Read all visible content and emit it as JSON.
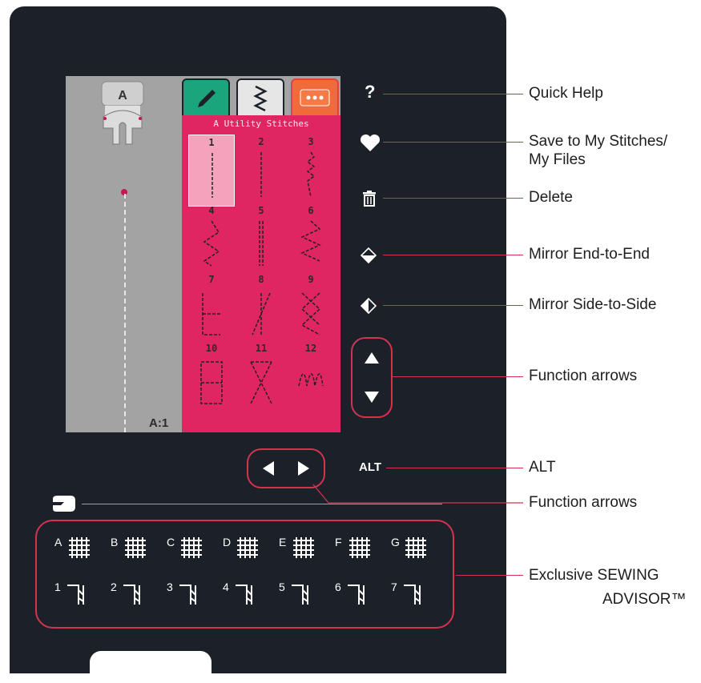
{
  "screen": {
    "position_label": "A:1",
    "category_title": "A Utility Stitches",
    "presser_foot_letter": "A",
    "tabs": [
      {
        "icon": "pencil-icon"
      },
      {
        "icon": "zigzag-icon"
      },
      {
        "icon": "more-icon"
      }
    ],
    "stitches": [
      "1",
      "2",
      "3",
      "4",
      "5",
      "6",
      "7",
      "8",
      "9",
      "10",
      "11",
      "12"
    ],
    "selected_stitch": "1"
  },
  "callouts": {
    "quick_help": "Quick Help",
    "save_line1": "Save to My Stitches/",
    "save_line2": "My Files",
    "delete": "Delete",
    "mirror_end": "Mirror End-to-End",
    "mirror_side": "Mirror Side-to-Side",
    "function_arrows_v": "Function arrows",
    "alt": "ALT",
    "function_arrows_h": "Function arrows",
    "advisor_line1": "Exclusive SEWING",
    "advisor_line2": "ADVISOR™"
  },
  "buttons": {
    "help_glyph": "?",
    "alt_label": "ALT"
  },
  "advisor": {
    "fabrics": [
      "A",
      "B",
      "C",
      "D",
      "E",
      "F",
      "G"
    ],
    "techniques": [
      "1",
      "2",
      "3",
      "4",
      "5",
      "6",
      "7"
    ]
  },
  "colors": {
    "panel": "#1c2129",
    "accent": "#d5324f",
    "stitch_pane": "#e02563",
    "edit_tab": "#1aa57c",
    "more_tab": "#f16a3a"
  }
}
